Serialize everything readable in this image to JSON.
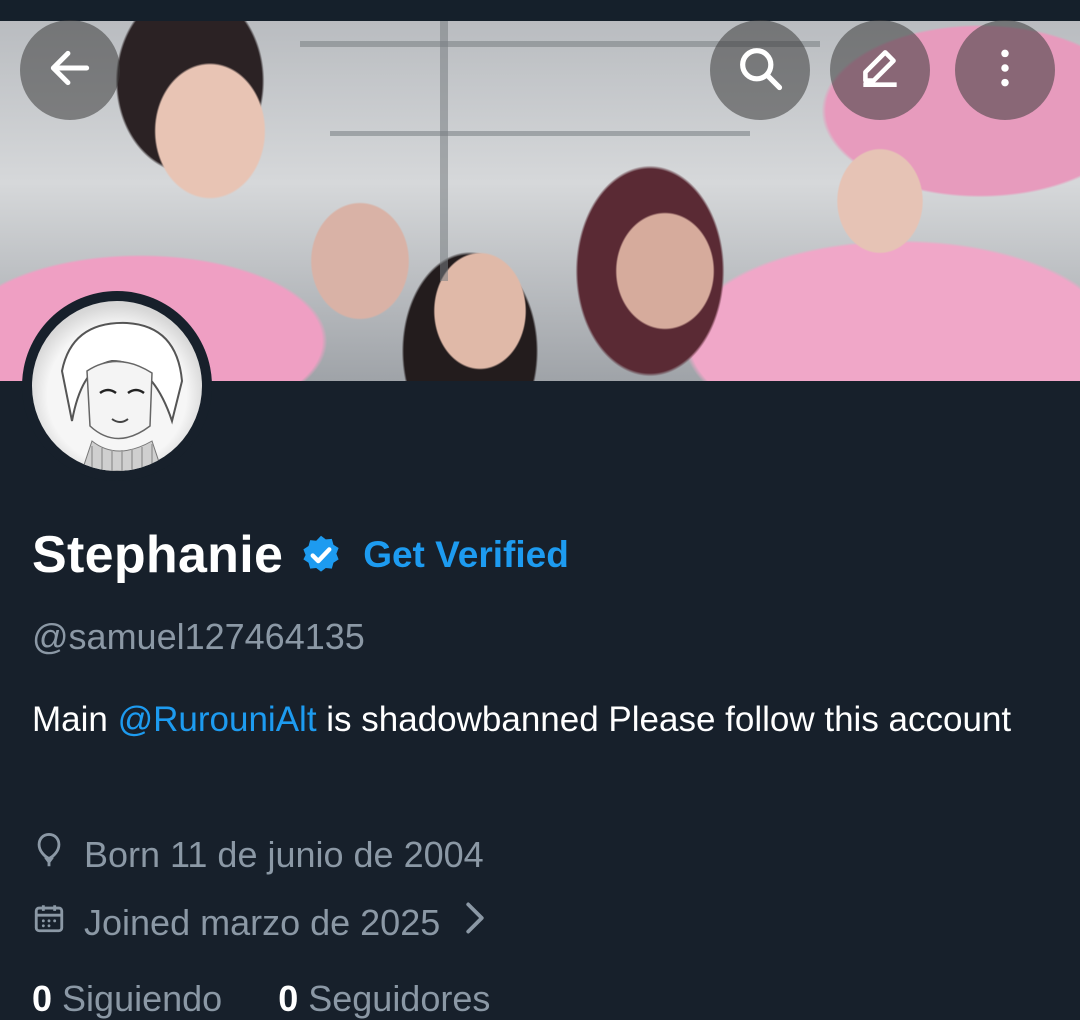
{
  "header": {
    "back_icon": "arrow-left-icon",
    "actions": [
      {
        "icon": "search-icon"
      },
      {
        "icon": "edit-pencil-icon"
      },
      {
        "icon": "more-vertical-icon"
      }
    ]
  },
  "profile": {
    "display_name": "Stephanie",
    "verified_badge_icon": "verified-badge-icon",
    "get_verified_label": "Get Verified",
    "handle": "@samuel127464135",
    "bio": {
      "prefix": "Main ",
      "mention": "@RurouniAlt",
      "suffix": " is shadowbanned Please follow this account"
    },
    "born_text": "Born 11 de junio de 2004",
    "joined_text": "Joined marzo de 2025",
    "following_count": "0",
    "following_label": " Siguiendo",
    "followers_count": "0",
    "followers_label": " Seguidores"
  },
  "colors": {
    "background": "#17202b",
    "accent": "#1d9bf0",
    "muted_text": "#8b98a5"
  }
}
